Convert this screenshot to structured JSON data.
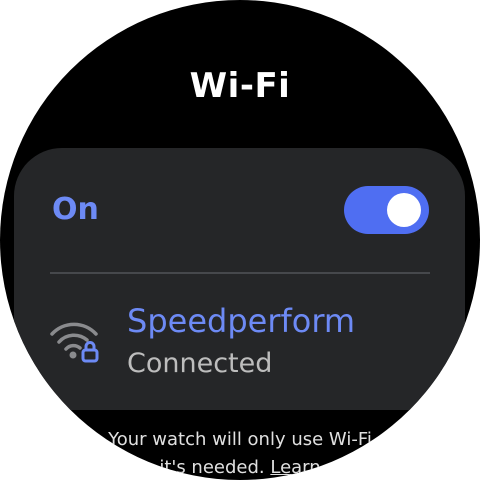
{
  "header": {
    "title": "Wi-Fi"
  },
  "wifi_toggle": {
    "label": "On",
    "state": "on",
    "accent_color": "#4f6ef2"
  },
  "network": {
    "icon": "wifi-lock-icon",
    "name": "Speedperform",
    "status": "Connected"
  },
  "footer": {
    "line1": "Your watch will only use Wi-Fi",
    "line2_text": "it's needed.",
    "line2_link": "Learn"
  },
  "colors": {
    "background": "#000000",
    "card": "#252628",
    "accent_text": "#6d8af5",
    "secondary_text": "#bdbdbd"
  }
}
